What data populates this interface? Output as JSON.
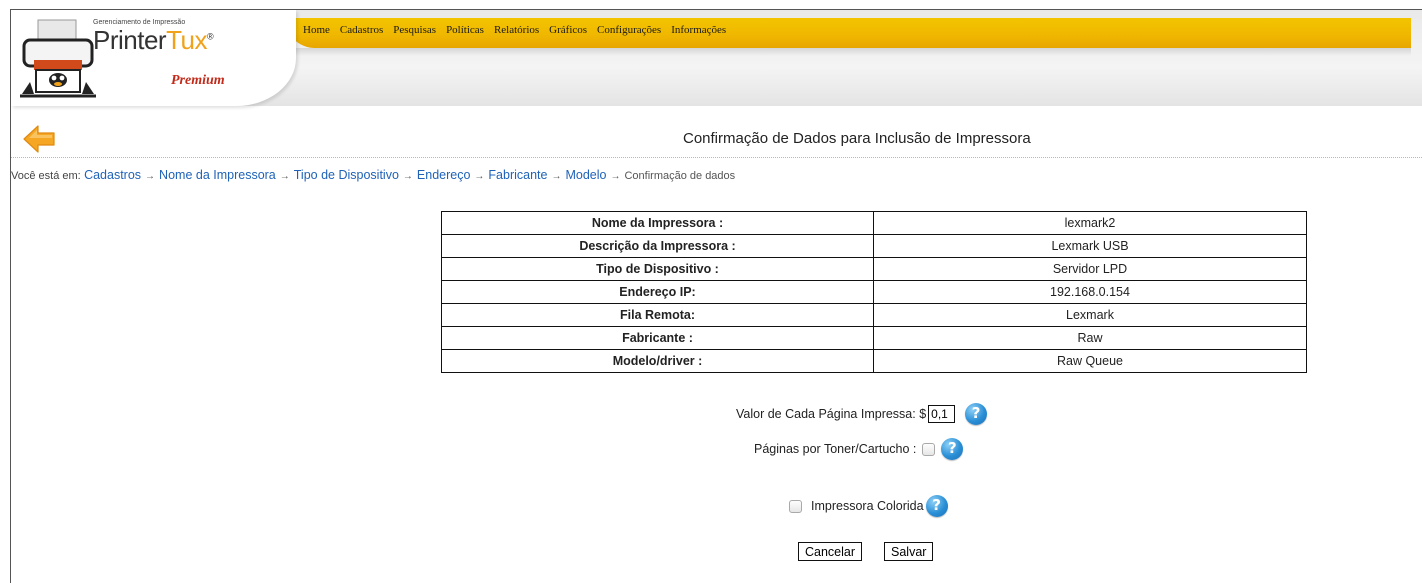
{
  "logo": {
    "subtitle": "Gerenciamento de Impressão",
    "name_part1": "Printer",
    "name_part2": "Tux",
    "registered": "®",
    "edition": "Premium"
  },
  "nav": [
    "Home",
    "Cadastros",
    "Pesquisas",
    "Políticas",
    "Relatórios",
    "Gráficos",
    "Configurações",
    "Informações"
  ],
  "page_title": "Confirmação de Dados para Inclusão de Impressora",
  "breadcrumb": {
    "prefix": "Você está em:",
    "links": [
      "Cadastros",
      "Nome da Impressora",
      "Tipo de Dispositivo",
      "Endereço",
      "Fabricante",
      "Modelo"
    ],
    "current": "Confirmação de dados"
  },
  "details": [
    {
      "label": "Nome da Impressora :",
      "value": "lexmark2"
    },
    {
      "label": "Descrição da Impressora :",
      "value": "Lexmark USB"
    },
    {
      "label": "Tipo de Dispositivo :",
      "value": "Servidor LPD"
    },
    {
      "label": "Endereço IP:",
      "value": "192.168.0.154"
    },
    {
      "label": "Fila Remota:",
      "value": "Lexmark"
    },
    {
      "label": "Fabricante :",
      "value": "Raw"
    },
    {
      "label": "Modelo/driver :",
      "value": "Raw Queue"
    }
  ],
  "form": {
    "page_value_label": "Valor de Cada Página Impressa: $",
    "page_value": "0,1",
    "pages_per_toner_label": "Páginas por Toner/Cartucho :",
    "color_printer_label": "Impressora Colorida"
  },
  "buttons": {
    "cancel": "Cancelar",
    "save": "Salvar"
  },
  "colors": {
    "nav_bar": "#f0b800",
    "link": "#1f62b8",
    "back_arrow": "#f0a21b",
    "help_icon": "#2a8fd6"
  },
  "icons": {
    "back": "back-arrow-icon",
    "help": "help-icon",
    "logo": "printer-tux-icon"
  }
}
